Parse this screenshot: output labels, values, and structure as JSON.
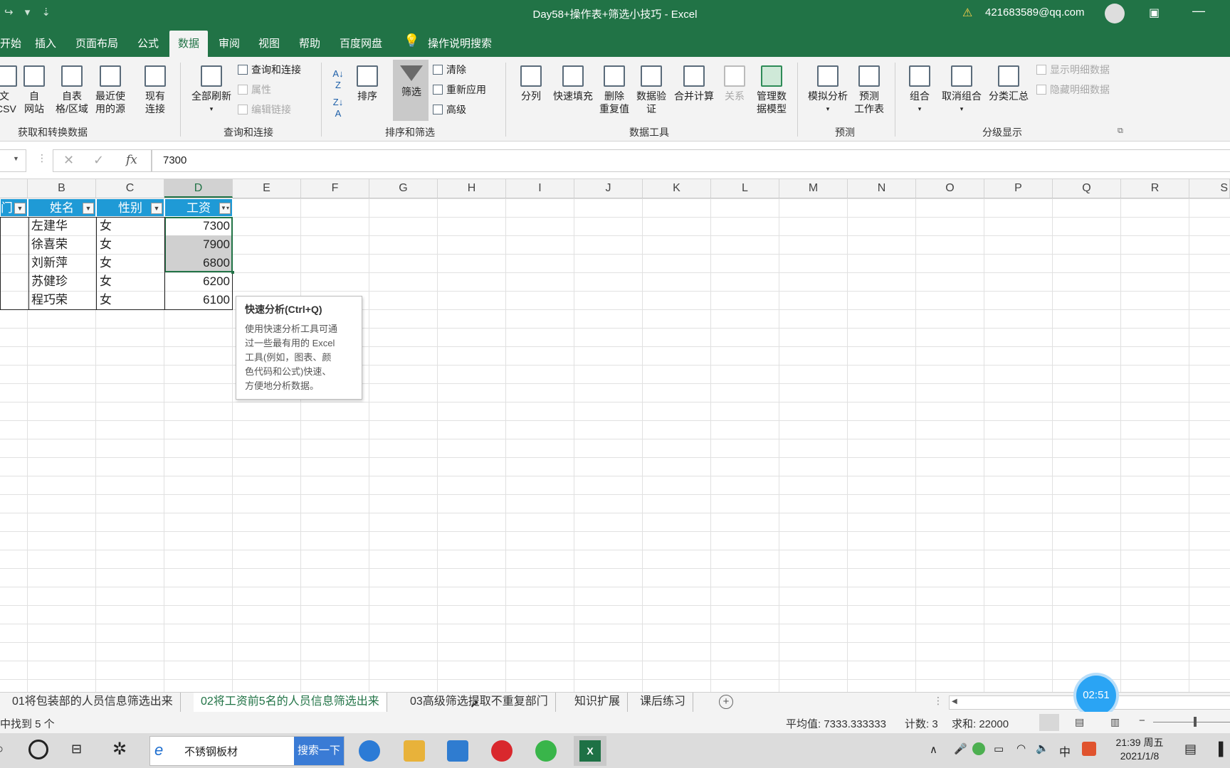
{
  "title_bar": {
    "title": "Day58+操作表+筛选小技巧  -  Excel",
    "account": "421683589@qq.com",
    "qat": "↪ ▾ ⇣"
  },
  "menu_tabs": [
    "开始",
    "插入",
    "页面布局",
    "公式",
    "数据",
    "审阅",
    "视图",
    "帮助",
    "百度网盘",
    "操作说明搜索"
  ],
  "active_tab": "数据",
  "ribbon": {
    "get_transform": {
      "label": "获取和转换数据",
      "items": [
        "文\nCSV",
        "自\n网站",
        "自表\n格/区域",
        "最近使\n用的源",
        "现有\n连接"
      ]
    },
    "queries": {
      "label": "查询和连接",
      "refresh_all": "全部刷新",
      "queries_conn": "查询和连接",
      "properties": "属性",
      "edit_links": "编辑链接"
    },
    "sort_filter": {
      "label": "排序和筛选",
      "sort": "排序",
      "filter": "筛选",
      "clear": "清除",
      "reapply": "重新应用",
      "advanced": "高级"
    },
    "data_tools": {
      "label": "数据工具",
      "split": "分列",
      "flash_fill": "快速填充",
      "remove_dup": "删除\n重复值",
      "validation": "数据验\n证",
      "consolidate": "合并计算",
      "relations": "关系",
      "manage_model": "管理数\n据模型"
    },
    "forecast": {
      "label": "预测",
      "what_if": "模拟分析",
      "forecast_sheet": "预测\n工作表"
    },
    "outline": {
      "label": "分级显示",
      "group": "组合",
      "ungroup": "取消组合",
      "subtotal": "分类汇总",
      "show_detail": "显示明细数据",
      "hide_detail": "隐藏明细数据"
    }
  },
  "formula_bar": {
    "value": "7300",
    "fx": "fx"
  },
  "columns": [
    "B",
    "C",
    "D",
    "E",
    "F",
    "G",
    "H",
    "I",
    "J",
    "K",
    "L",
    "M",
    "N",
    "O",
    "P",
    "Q",
    "R",
    "S"
  ],
  "table": {
    "first_header_fragment": "门",
    "headers": [
      "姓名",
      "性别",
      "工资"
    ],
    "rows": [
      [
        "左建华",
        "女",
        "7300"
      ],
      [
        "徐喜荣",
        "女",
        "7900"
      ],
      [
        "刘新萍",
        "女",
        "6800"
      ],
      [
        "苏健珍",
        "女",
        "6200"
      ],
      [
        "程巧荣",
        "女",
        "6100"
      ]
    ]
  },
  "tooltip": {
    "title": "快速分析(Ctrl+Q)",
    "body": "使用快速分析工具可通\n过一些最有用的 Excel\n工具(例如，图表、颜\n色代码和公式)快速、\n方便地分析数据。"
  },
  "sheets": [
    "01将包装部的人员信息筛选出来",
    "02将工资前5名的人员信息筛选出来",
    "03高级筛选提取不重复部门",
    "知识扩展",
    "课后练习"
  ],
  "active_sheet": "02将工资前5名的人员信息筛选出来",
  "timer": "02:51",
  "status": {
    "left": "中找到 5 个",
    "average": "平均值: 7333.333333",
    "count": "计数: 3",
    "sum": "求和: 22000"
  },
  "taskbar": {
    "search_text": "不锈钢板材",
    "search_button": "搜索一下",
    "time": "21:39 周五",
    "date": "2021/1/8",
    "ime": "中"
  },
  "colors": {
    "excel_green": "#217346",
    "header_blue": "#1f9ad6"
  }
}
